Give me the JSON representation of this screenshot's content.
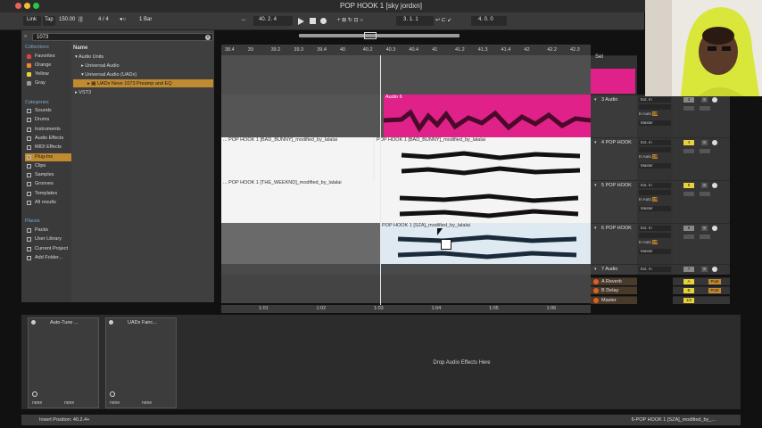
{
  "window": {
    "title": "POP HOOK 1  [sky jordxn]"
  },
  "transport": {
    "link": "Link",
    "tap": "Tap",
    "tempo": "150.00",
    "time_sig": "4 / 4",
    "quant": "1 Bar",
    "position": "40.  2.  4",
    "loop_start": "3.  1.  1",
    "loop_len": "4.  0.  0"
  },
  "search": {
    "value": "1073"
  },
  "sidebar": {
    "collections_head": "Collections",
    "collections": [
      {
        "label": "Favorites",
        "color": "#e04040"
      },
      {
        "label": "Orange",
        "color": "#f08a2c"
      },
      {
        "label": "Yellow",
        "color": "#e8d23a"
      },
      {
        "label": "Gray",
        "color": "#9a9a9a"
      }
    ],
    "categories_head": "Categories",
    "categories": [
      "Sounds",
      "Drums",
      "Instruments",
      "Audio Effects",
      "MIDI Effects",
      "Plug-Ins",
      "Clips",
      "Samples",
      "Grooves",
      "Templates",
      "All results"
    ],
    "places_head": "Places",
    "places": [
      "Packs",
      "User Library",
      "Current Project",
      "Add Folder..."
    ]
  },
  "browser": {
    "column": "Name",
    "tree": [
      "Audio Units",
      "Universal Audio",
      "Universal Audio (UADx)",
      "UADx Neve 1073 Preamp and EQ",
      "VST3"
    ]
  },
  "ruler": {
    "top": [
      "38.4",
      "39",
      "39.2",
      "39.3",
      "39.4",
      "40",
      "40.2",
      "40.3",
      "40.4",
      "41",
      "41.2",
      "41.3",
      "41.4",
      "42",
      "42.2",
      "42.3"
    ],
    "bottom": [
      "1:01",
      "1:02",
      "1:03",
      "1:04",
      "1:05",
      "1:06"
    ]
  },
  "clips": {
    "audio6": "Audio 6",
    "bad_bunny_a": "... POP HOOK 1  [BAD_BUNNY]_modified_by_lalalai",
    "bad_bunny_b": "POP HOOK 1  [BAD_BUNNY]_modified_by_lalalai",
    "weeknd": "... POP HOOK 1  [THE_WEEKND]_modified_by_lalalai",
    "sza": "POP HOOK 1  [SZA]_modified_by_lalalai"
  },
  "tracks": [
    {
      "name": "3 Audio",
      "num": "3",
      "input": "Ext. In",
      "output": "Master"
    },
    {
      "name": "4 POP HOOK",
      "num": "4",
      "input": "Ext. In",
      "output": "Master"
    },
    {
      "name": "5 POP HOOK",
      "num": "5",
      "input": "Ext. In",
      "output": "Master"
    },
    {
      "name": "6 POP HOOK",
      "num": "6",
      "input": "Ext. In",
      "output": "Master"
    },
    {
      "name": "7 Audio",
      "num": "7",
      "input": "Ext. In",
      "output": "Master"
    }
  ],
  "returns": [
    {
      "name": "A Reverb",
      "num": "A",
      "post": "Post"
    },
    {
      "name": "B Delay",
      "num": "B",
      "post": "Post"
    },
    {
      "name": "Master",
      "num": "1/2",
      "post": ""
    }
  ],
  "set_label": "Set",
  "io_labels": {
    "in": "In",
    "auto": "Auto",
    "off": "Off",
    "solo": "S"
  },
  "devices": [
    {
      "title": "Auto-Tune ...",
      "sel_a": "none",
      "sel_b": "none"
    },
    {
      "title": "UADx Fairc...",
      "sel_a": "none",
      "sel_b": "none"
    }
  ],
  "drop_text": "Drop Audio Effects Here",
  "status": {
    "left": "Insert Position: 40.2.4+",
    "right": "6-POP HOOK 1  [SZA]_modified_by_..."
  },
  "colors": {
    "accent": "#c08a30",
    "pink_clip": "#e0218a",
    "selection": "#dfe9f2"
  }
}
